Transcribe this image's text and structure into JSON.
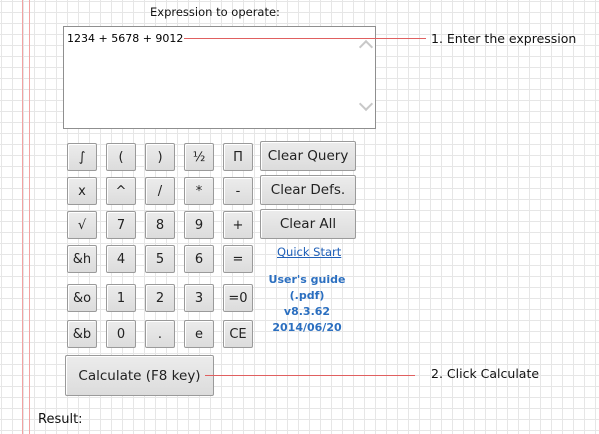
{
  "header": {
    "title": "Expression to operate:"
  },
  "expression": {
    "value": "1234 + 5678 + 9012"
  },
  "keypad": [
    [
      "∫",
      "(",
      ")",
      "½",
      "Π"
    ],
    [
      "x",
      "^",
      "/",
      "*",
      "-"
    ],
    [
      "√",
      "7",
      "8",
      "9",
      "+"
    ],
    [
      "&h",
      "4",
      "5",
      "6",
      "="
    ],
    [
      "&o",
      "1",
      "2",
      "3",
      "=0"
    ],
    [
      "&b",
      "0",
      ".",
      "e",
      "CE"
    ]
  ],
  "actions": {
    "clear_query": "Clear Query",
    "clear_defs": "Clear Defs.",
    "clear_all": "Clear All",
    "quick_start": "Quick Start",
    "calculate": "Calculate (F8 key)"
  },
  "info": {
    "guide_line1": "User's guide",
    "guide_line2": "(.pdf)",
    "version": "v8.3.62",
    "date": "2014/06/20"
  },
  "callouts": {
    "step1": "1. Enter the expression",
    "step2": "2. Click Calculate"
  },
  "result": {
    "label": "Result:"
  },
  "colors": {
    "link": "#2060b8",
    "callout": "#e06060"
  }
}
